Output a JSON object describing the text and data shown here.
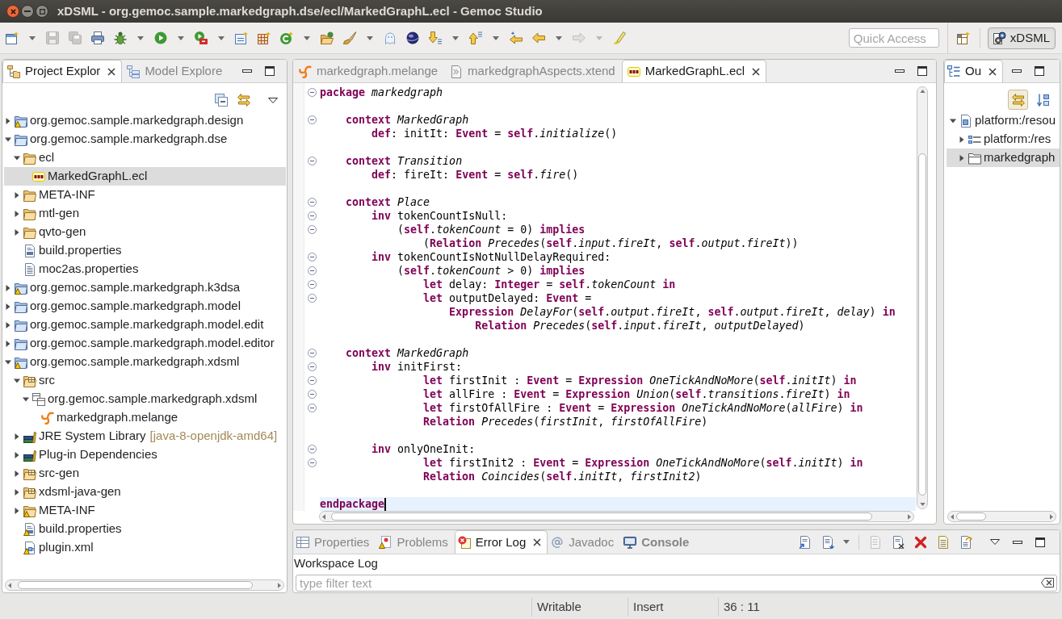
{
  "window": {
    "title": "xDSML - org.gemoc.sample.markedgraph.dse/ecl/MarkedGraphL.ecl - Gemoc Studio"
  },
  "toolbar": {
    "buttons": [
      {
        "kind": "new",
        "disabled": false,
        "dropdown": true
      },
      {
        "kind": "save",
        "disabled": true,
        "dropdown": false
      },
      {
        "kind": "saveall",
        "disabled": true,
        "dropdown": false
      },
      {
        "kind": "print",
        "disabled": false,
        "dropdown": false
      },
      {
        "kind": "debug",
        "disabled": false,
        "dropdown": true
      },
      {
        "kind": "run",
        "disabled": false,
        "dropdown": true
      },
      {
        "kind": "external",
        "disabled": false,
        "dropdown": true
      },
      {
        "kind": "wizard",
        "disabled": false,
        "dropdown": false
      },
      {
        "kind": "grid",
        "disabled": false,
        "dropdown": false
      },
      {
        "kind": "class",
        "disabled": false,
        "dropdown": true
      },
      {
        "kind": "open",
        "disabled": false,
        "dropdown": false
      },
      {
        "kind": "brush",
        "disabled": false,
        "dropdown": true
      },
      {
        "kind": "ghost",
        "disabled": false,
        "dropdown": false
      },
      {
        "kind": "sphere",
        "disabled": false,
        "dropdown": false
      },
      {
        "kind": "down",
        "disabled": false,
        "dropdown": true
      },
      {
        "kind": "up",
        "disabled": false,
        "dropdown": true
      },
      {
        "kind": "lastedit",
        "disabled": false,
        "dropdown": false
      },
      {
        "kind": "back",
        "disabled": false,
        "dropdown": true
      },
      {
        "kind": "forward",
        "disabled": true,
        "dropdown": true
      },
      {
        "kind": "pin",
        "disabled": false,
        "dropdown": false
      }
    ],
    "quick_access": {
      "placeholder": "Quick Access"
    },
    "perspective": {
      "label": "xDSML",
      "selected": true
    }
  },
  "project_explorer": {
    "tabs": [
      {
        "label": "Project Explor",
        "kind": "explorer",
        "selected": true
      },
      {
        "label": "Model Explore",
        "kind": "models",
        "selected": false
      }
    ],
    "tree": [
      {
        "label": "org.gemoc.sample.markedgraph.design",
        "kind": "project",
        "warning": true,
        "expanded": false,
        "selected": false
      },
      {
        "label": "org.gemoc.sample.markedgraph.dse",
        "kind": "project",
        "warning": false,
        "expanded": true,
        "selected": false,
        "children": [
          {
            "label": "ecl",
            "kind": "folder",
            "warning": false,
            "expanded": true,
            "selected": false,
            "children": [
              {
                "label": "MarkedGraphL.ecl",
                "kind": "ecl",
                "warning": false,
                "selected": true
              }
            ]
          },
          {
            "label": "META-INF",
            "kind": "folder",
            "warning": false,
            "expanded": false,
            "selected": false
          },
          {
            "label": "mtl-gen",
            "kind": "folder",
            "warning": false,
            "expanded": false,
            "selected": false
          },
          {
            "label": "qvto-gen",
            "kind": "folder",
            "warning": false,
            "expanded": false,
            "selected": false
          },
          {
            "label": "build.properties",
            "kind": "properties",
            "warning": false,
            "selected": false
          },
          {
            "label": "moc2as.properties",
            "kind": "text",
            "warning": false,
            "selected": false
          }
        ]
      },
      {
        "label": "org.gemoc.sample.markedgraph.k3dsa",
        "kind": "project",
        "warning": true,
        "expanded": false,
        "selected": false
      },
      {
        "label": "org.gemoc.sample.markedgraph.model",
        "kind": "project",
        "warning": false,
        "expanded": false,
        "selected": false
      },
      {
        "label": "org.gemoc.sample.markedgraph.model.edit",
        "kind": "project",
        "warning": false,
        "expanded": false,
        "selected": false
      },
      {
        "label": "org.gemoc.sample.markedgraph.model.editor",
        "kind": "project",
        "warning": false,
        "expanded": false,
        "selected": false
      },
      {
        "label": "org.gemoc.sample.markedgraph.xdsml",
        "kind": "project",
        "warning": true,
        "expanded": true,
        "selected": false,
        "children": [
          {
            "label": "src",
            "kind": "source-folder",
            "warning": false,
            "expanded": true,
            "selected": false,
            "children": [
              {
                "label": "org.gemoc.sample.markedgraph.xdsml",
                "kind": "package",
                "warning": false,
                "expanded": true,
                "selected": false,
                "children": [
                  {
                    "label": "markedgraph.melange",
                    "kind": "melange",
                    "warning": false,
                    "selected": false
                  }
                ]
              }
            ]
          },
          {
            "label": "JRE System Library",
            "decoration": "[java-8-openjdk-amd64]",
            "kind": "library",
            "warning": false,
            "expanded": false,
            "selected": false
          },
          {
            "label": "Plug-in Dependencies",
            "kind": "library",
            "warning": false,
            "expanded": false,
            "selected": false
          },
          {
            "label": "src-gen",
            "kind": "source-folder",
            "warning": false,
            "expanded": false,
            "selected": false
          },
          {
            "label": "xdsml-java-gen",
            "kind": "source-folder",
            "warning": false,
            "expanded": false,
            "selected": false
          },
          {
            "label": "META-INF",
            "kind": "folder",
            "warning": true,
            "expanded": false,
            "selected": false
          },
          {
            "label": "build.properties",
            "kind": "properties",
            "warning": true,
            "selected": false
          },
          {
            "label": "plugin.xml",
            "kind": "xml",
            "warning": true,
            "selected": false
          }
        ]
      }
    ]
  },
  "editor": {
    "tabs": [
      {
        "label": "markedgraph.melange",
        "kind": "melange",
        "selected": false
      },
      {
        "label": "markedgraphAspects.xtend",
        "kind": "xtend",
        "selected": false
      },
      {
        "label": "MarkedGraphL.ecl",
        "kind": "ecl",
        "selected": true
      }
    ],
    "blocks": [
      {
        "lines": [
          {
            "text": "**package** *markedgraph*",
            "foldable": true,
            "current": false
          }
        ]
      },
      {
        "lines": [
          {
            "text": "    **context** *MarkedGraph*",
            "foldable": true,
            "current": false
          },
          {
            "text": "        **def**: initIt: **Event** = **self**.*initialize*()",
            "foldable": false,
            "current": false
          }
        ]
      },
      {
        "lines": [
          {
            "text": "    **context** *Transition*",
            "foldable": true,
            "current": false
          },
          {
            "text": "        **def**: fireIt: **Event** = **self**.*fire*()",
            "foldable": false,
            "current": false
          }
        ]
      },
      {
        "lines": [
          {
            "text": "    **context** *Place*",
            "foldable": true,
            "current": false
          },
          {
            "text": "        **inv** tokenCountIsNull:",
            "foldable": true,
            "current": false
          },
          {
            "text": "            (**self**.*tokenCount* = 0) **implies**",
            "foldable": true,
            "current": false
          },
          {
            "text": "                (**Relation** *Precedes*(**self**.*input*.*fireIt*, **self**.*output*.*fireIt*))",
            "foldable": false,
            "current": false
          },
          {
            "text": "        **inv** tokenCountIsNotNullDelayRequired:",
            "foldable": true,
            "current": false
          },
          {
            "text": "            (**self**.*tokenCount* > 0) **implies**",
            "foldable": true,
            "current": false
          },
          {
            "text": "                **let** delay: **Integer** = **self**.*tokenCount* **in**",
            "foldable": true,
            "current": false
          },
          {
            "text": "                **let** outputDelayed: **Event** =",
            "foldable": true,
            "current": false
          },
          {
            "text": "                    **Expression** *DelayFor*(**self**.*output*.*fireIt*, **self**.*output*.*fireIt*, *delay*) **in**",
            "foldable": false,
            "current": false
          },
          {
            "text": "                        **Relation** *Precedes*(**self**.*input*.*fireIt*, *outputDelayed*)",
            "foldable": false,
            "current": false
          }
        ]
      },
      {
        "lines": [
          {
            "text": "    **context** *MarkedGraph*",
            "foldable": true,
            "current": false
          },
          {
            "text": "        **inv** initFirst:",
            "foldable": true,
            "current": false
          },
          {
            "text": "                **let** firstInit : **Event** = **Expression** *OneTickAndNoMore*(**self**.*initIt*) **in**",
            "foldable": true,
            "current": false
          },
          {
            "text": "                **let** allFire : **Event** = **Expression** *Union*(**self**.*transitions*.*fireIt*) **in**",
            "foldable": true,
            "current": false
          },
          {
            "text": "                **let** firstOfAllFire : **Event** = **Expression** *OneTickAndNoMore*(*allFire*) **in**",
            "foldable": true,
            "current": false
          },
          {
            "text": "                **Relation** *Precedes*(*firstInit*, *firstOfAllFire*)",
            "foldable": false,
            "current": false
          }
        ]
      },
      {
        "lines": [
          {
            "text": "        **inv** onlyOneInit:",
            "foldable": true,
            "current": false
          },
          {
            "text": "                **let** firstInit2 : **Event** = **Expression** *OneTickAndNoMore*(**self**.*initIt*) **in**",
            "foldable": true,
            "current": false
          },
          {
            "text": "                **Relation** *Coincides*(**self**.*initIt*, *firstInit2*)",
            "foldable": false,
            "current": false
          }
        ]
      },
      {
        "lines": [
          {
            "text": "**endpackage**",
            "foldable": false,
            "current": true
          }
        ]
      }
    ]
  },
  "outline": {
    "tabs": [
      {
        "label": "Ou",
        "kind": "outline",
        "selected": true
      }
    ],
    "toolbar": [
      {
        "kind": "link",
        "on": true
      },
      {
        "kind": "sort",
        "on": false
      }
    ],
    "tree": [
      {
        "label": "platform:/resou",
        "kind": "resource",
        "expanded": true,
        "selected": false,
        "children": [
          {
            "label": "platform:/res",
            "kind": "model",
            "expanded": false,
            "selected": false
          },
          {
            "label": "markedgraph",
            "kind": "epackage",
            "expanded": false,
            "selected": true
          }
        ]
      }
    ]
  },
  "bottom_panel": {
    "tabs": [
      {
        "label": "Properties",
        "kind": "properties",
        "selected": false,
        "updated": false
      },
      {
        "label": "Problems",
        "kind": "problems",
        "selected": false,
        "updated": false
      },
      {
        "label": "Error Log",
        "kind": "errorlog",
        "selected": true,
        "updated": false
      },
      {
        "label": "Javadoc",
        "kind": "javadoc",
        "selected": false,
        "updated": false
      },
      {
        "label": "Console",
        "kind": "console",
        "selected": false,
        "updated": true
      }
    ],
    "toolbar": [
      {
        "kind": "export",
        "disabled": false,
        "dropdown": false
      },
      {
        "kind": "import",
        "disabled": false,
        "dropdown": true
      },
      {
        "kind": "openlog",
        "disabled": true,
        "dropdown": false
      },
      {
        "kind": "clear",
        "disabled": false,
        "dropdown": false
      },
      {
        "kind": "delete",
        "disabled": false,
        "dropdown": false
      },
      {
        "kind": "document",
        "disabled": false,
        "dropdown": false
      },
      {
        "kind": "restore",
        "disabled": false,
        "dropdown": false
      }
    ],
    "log_title": "Workspace Log",
    "filter": {
      "placeholder": "type filter text"
    }
  },
  "status_bar": {
    "fields": [
      "Writable",
      "Insert",
      "36 : 11"
    ]
  }
}
